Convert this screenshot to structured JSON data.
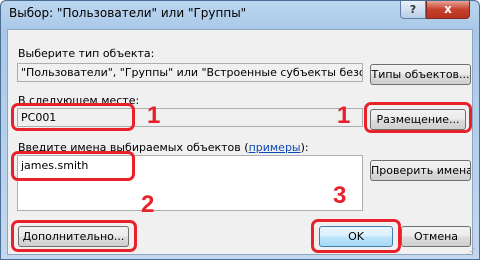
{
  "window": {
    "title": "Выбор: \"Пользователи\" или \"Группы\"",
    "help_label": "?",
    "close_label": "x"
  },
  "object_type": {
    "label": "Выберите тип объекта:",
    "value": "\"Пользователи\", \"Группы\" или \"Встроенные субъекты безопасно",
    "button": "Типы объектов..."
  },
  "location": {
    "label": "В следующем месте:",
    "value": "PC001",
    "button": "Размещение..."
  },
  "names": {
    "label_prefix": "Введите имена выбираемых объектов (",
    "label_link": "примеры",
    "label_suffix": "):",
    "value": "james.smith",
    "check_button": "Проверить имена"
  },
  "footer": {
    "advanced_button": "Дополнительно...",
    "ok_button": "OK",
    "cancel_button": "Отмена"
  },
  "callouts": {
    "location_number": "1",
    "location_button_number": "1",
    "advanced_number": "2",
    "ok_number": "3",
    "color": "#e8212b"
  }
}
